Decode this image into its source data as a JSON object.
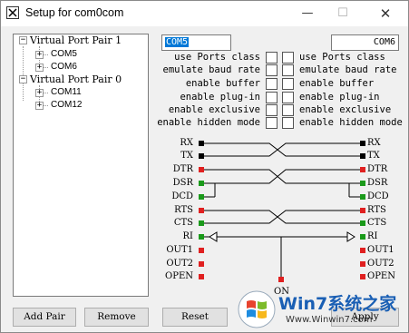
{
  "window": {
    "title": "Setup for com0com",
    "controls": {
      "minimize": "—",
      "maximize": "☐",
      "close": "✕"
    }
  },
  "tree": {
    "pairs": [
      {
        "label": "Virtual Port Pair 1",
        "ports": [
          "COM5",
          "COM6"
        ]
      },
      {
        "label": "Virtual Port Pair 0",
        "ports": [
          "COM11",
          "COM12"
        ]
      }
    ]
  },
  "port_a": {
    "name": "COM5"
  },
  "port_b": {
    "name": "COM6"
  },
  "options": [
    "use Ports class",
    "emulate baud rate",
    "enable buffer",
    "enable plug-in",
    "enable exclusive",
    "enable hidden mode"
  ],
  "signals": {
    "left": [
      "RX",
      "TX",
      "DTR",
      "DSR",
      "DCD",
      "RTS",
      "CTS",
      "RI",
      "OUT1",
      "OUT2",
      "OPEN"
    ],
    "right": [
      "RX",
      "TX",
      "DTR",
      "DSR",
      "DCD",
      "RTS",
      "CTS",
      "RI",
      "OUT1",
      "OUT2",
      "OPEN"
    ],
    "on_label": "ON",
    "colors": {
      "black": "#000000",
      "red": "#e02020",
      "green": "#1a9a1a",
      "line": "#000000"
    }
  },
  "buttons": {
    "add_pair": "Add Pair",
    "remove": "Remove",
    "reset": "Reset",
    "apply": "Apply"
  },
  "watermark": {
    "brand": "Win7系统之家",
    "url": "Www.Winwin7.com"
  }
}
